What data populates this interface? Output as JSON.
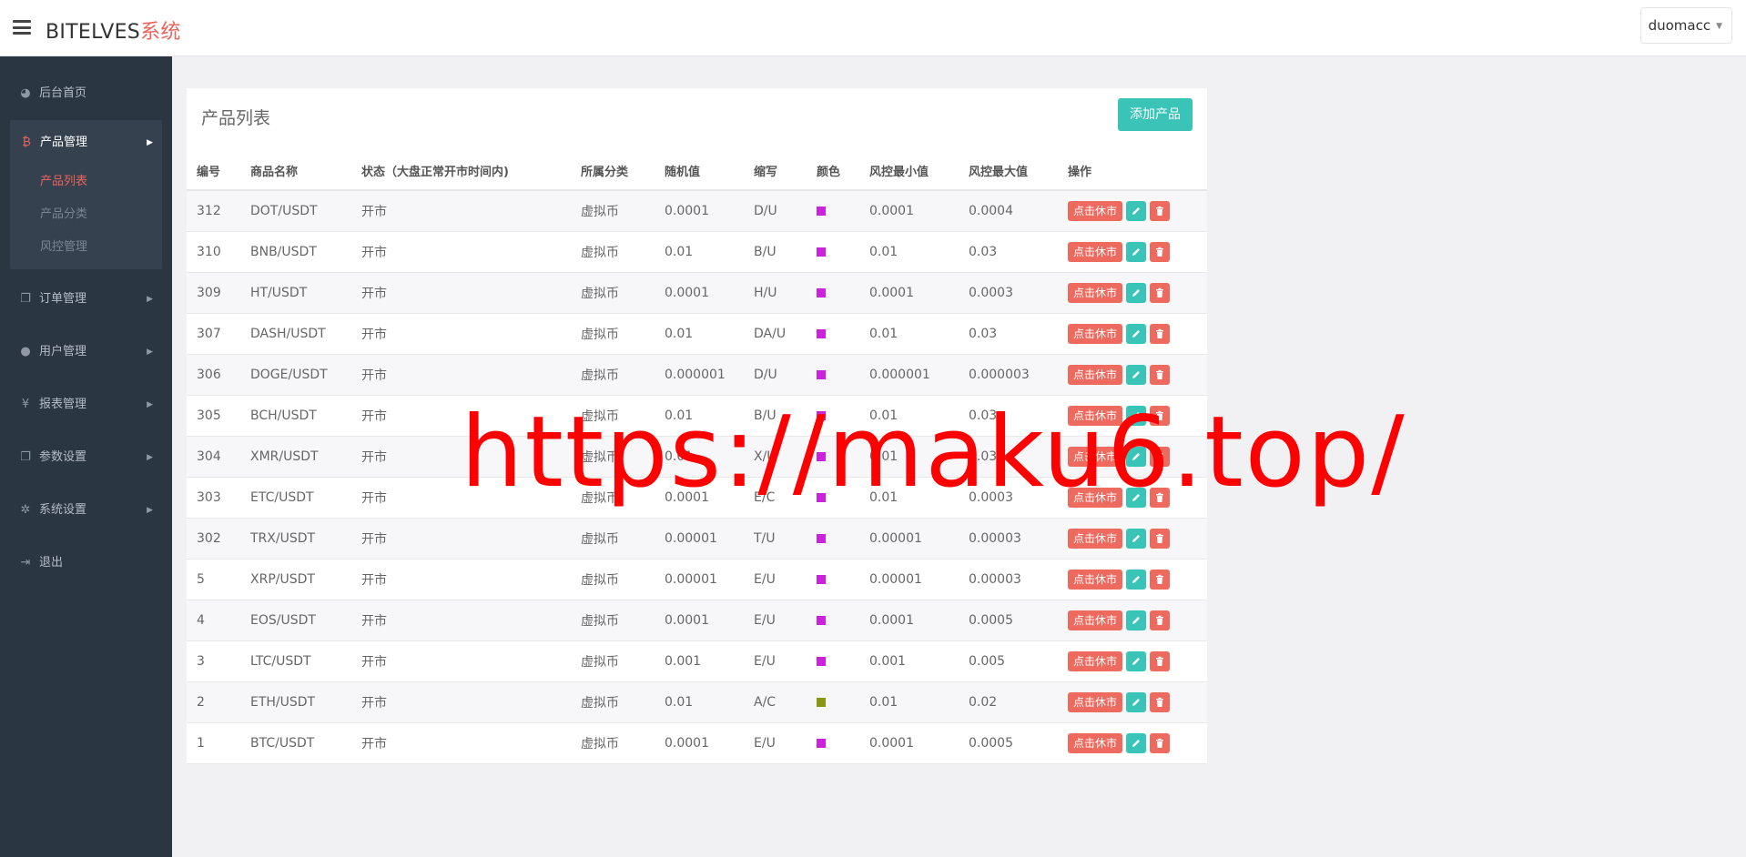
{
  "header": {
    "brand_main": "BITELVES",
    "brand_accent": "系统",
    "user_name": "duomacc"
  },
  "sidebar": {
    "items": [
      {
        "label": "后台首页",
        "icon": "dashboard-icon"
      },
      {
        "label": "产品管理",
        "icon": "bitcoin-icon",
        "expanded": true,
        "children": [
          {
            "label": "产品列表",
            "active": true
          },
          {
            "label": "产品分类"
          },
          {
            "label": "风控管理"
          }
        ]
      },
      {
        "label": "订单管理",
        "icon": "copy-icon"
      },
      {
        "label": "用户管理",
        "icon": "user-icon"
      },
      {
        "label": "报表管理",
        "icon": "yen-icon"
      },
      {
        "label": "参数设置",
        "icon": "copy-icon"
      },
      {
        "label": "系统设置",
        "icon": "gears-icon"
      },
      {
        "label": "退出",
        "icon": "sign-out-icon"
      }
    ]
  },
  "panel": {
    "title": "产品列表",
    "add_button": "添加产品"
  },
  "table": {
    "columns": [
      "编号",
      "商品名称",
      "状态（大盘正常开市时间内)",
      "所属分类",
      "随机值",
      "缩写",
      "颜色",
      "风控最小值",
      "风控最大值",
      "操作"
    ],
    "action_label": "点击休市",
    "rows": [
      {
        "id": "312",
        "name": "DOT/USDT",
        "status": "开市",
        "category": "虚拟币",
        "random": "0.0001",
        "abbr": "D/U",
        "color": "#cc22dd",
        "min": "0.0001",
        "max": "0.0004"
      },
      {
        "id": "310",
        "name": "BNB/USDT",
        "status": "开市",
        "category": "虚拟币",
        "random": "0.01",
        "abbr": "B/U",
        "color": "#cc22dd",
        "min": "0.01",
        "max": "0.03"
      },
      {
        "id": "309",
        "name": "HT/USDT",
        "status": "开市",
        "category": "虚拟币",
        "random": "0.0001",
        "abbr": "H/U",
        "color": "#cc22dd",
        "min": "0.0001",
        "max": "0.0003"
      },
      {
        "id": "307",
        "name": "DASH/USDT",
        "status": "开市",
        "category": "虚拟币",
        "random": "0.01",
        "abbr": "DA/U",
        "color": "#cc22dd",
        "min": "0.01",
        "max": "0.03"
      },
      {
        "id": "306",
        "name": "DOGE/USDT",
        "status": "开市",
        "category": "虚拟币",
        "random": "0.000001",
        "abbr": "D/U",
        "color": "#cc22dd",
        "min": "0.000001",
        "max": "0.000003"
      },
      {
        "id": "305",
        "name": "BCH/USDT",
        "status": "开市",
        "category": "虚拟币",
        "random": "0.01",
        "abbr": "B/U",
        "color": "#cc22dd",
        "min": "0.01",
        "max": "0.03"
      },
      {
        "id": "304",
        "name": "XMR/USDT",
        "status": "开市",
        "category": "虚拟币",
        "random": "0.01",
        "abbr": "X/U",
        "color": "#cc22dd",
        "min": "0.01",
        "max": "0.03"
      },
      {
        "id": "303",
        "name": "ETC/USDT",
        "status": "开市",
        "category": "虚拟币",
        "random": "0.0001",
        "abbr": "E/C",
        "color": "#cc22dd",
        "min": "0.01",
        "max": "0.0003"
      },
      {
        "id": "302",
        "name": "TRX/USDT",
        "status": "开市",
        "category": "虚拟币",
        "random": "0.00001",
        "abbr": "T/U",
        "color": "#cc22dd",
        "min": "0.00001",
        "max": "0.00003"
      },
      {
        "id": "5",
        "name": "XRP/USDT",
        "status": "开市",
        "category": "虚拟币",
        "random": "0.00001",
        "abbr": "E/U",
        "color": "#cc22dd",
        "min": "0.00001",
        "max": "0.00003"
      },
      {
        "id": "4",
        "name": "EOS/USDT",
        "status": "开市",
        "category": "虚拟币",
        "random": "0.0001",
        "abbr": "E/U",
        "color": "#cc22dd",
        "min": "0.0001",
        "max": "0.0005"
      },
      {
        "id": "3",
        "name": "LTC/USDT",
        "status": "开市",
        "category": "虚拟币",
        "random": "0.001",
        "abbr": "E/U",
        "color": "#cc22dd",
        "min": "0.001",
        "max": "0.005"
      },
      {
        "id": "2",
        "name": "ETH/USDT",
        "status": "开市",
        "category": "虚拟币",
        "random": "0.01",
        "abbr": "A/C",
        "color": "#889911",
        "min": "0.01",
        "max": "0.02"
      },
      {
        "id": "1",
        "name": "BTC/USDT",
        "status": "开市",
        "category": "虚拟币",
        "random": "0.0001",
        "abbr": "E/U",
        "color": "#cc22dd",
        "min": "0.0001",
        "max": "0.0005"
      }
    ]
  },
  "watermark": "https://maku6.top/",
  "colors": {
    "accent_red": "#e8645c",
    "teal": "#39c4b7",
    "sidebar_bg": "#2b3643"
  }
}
